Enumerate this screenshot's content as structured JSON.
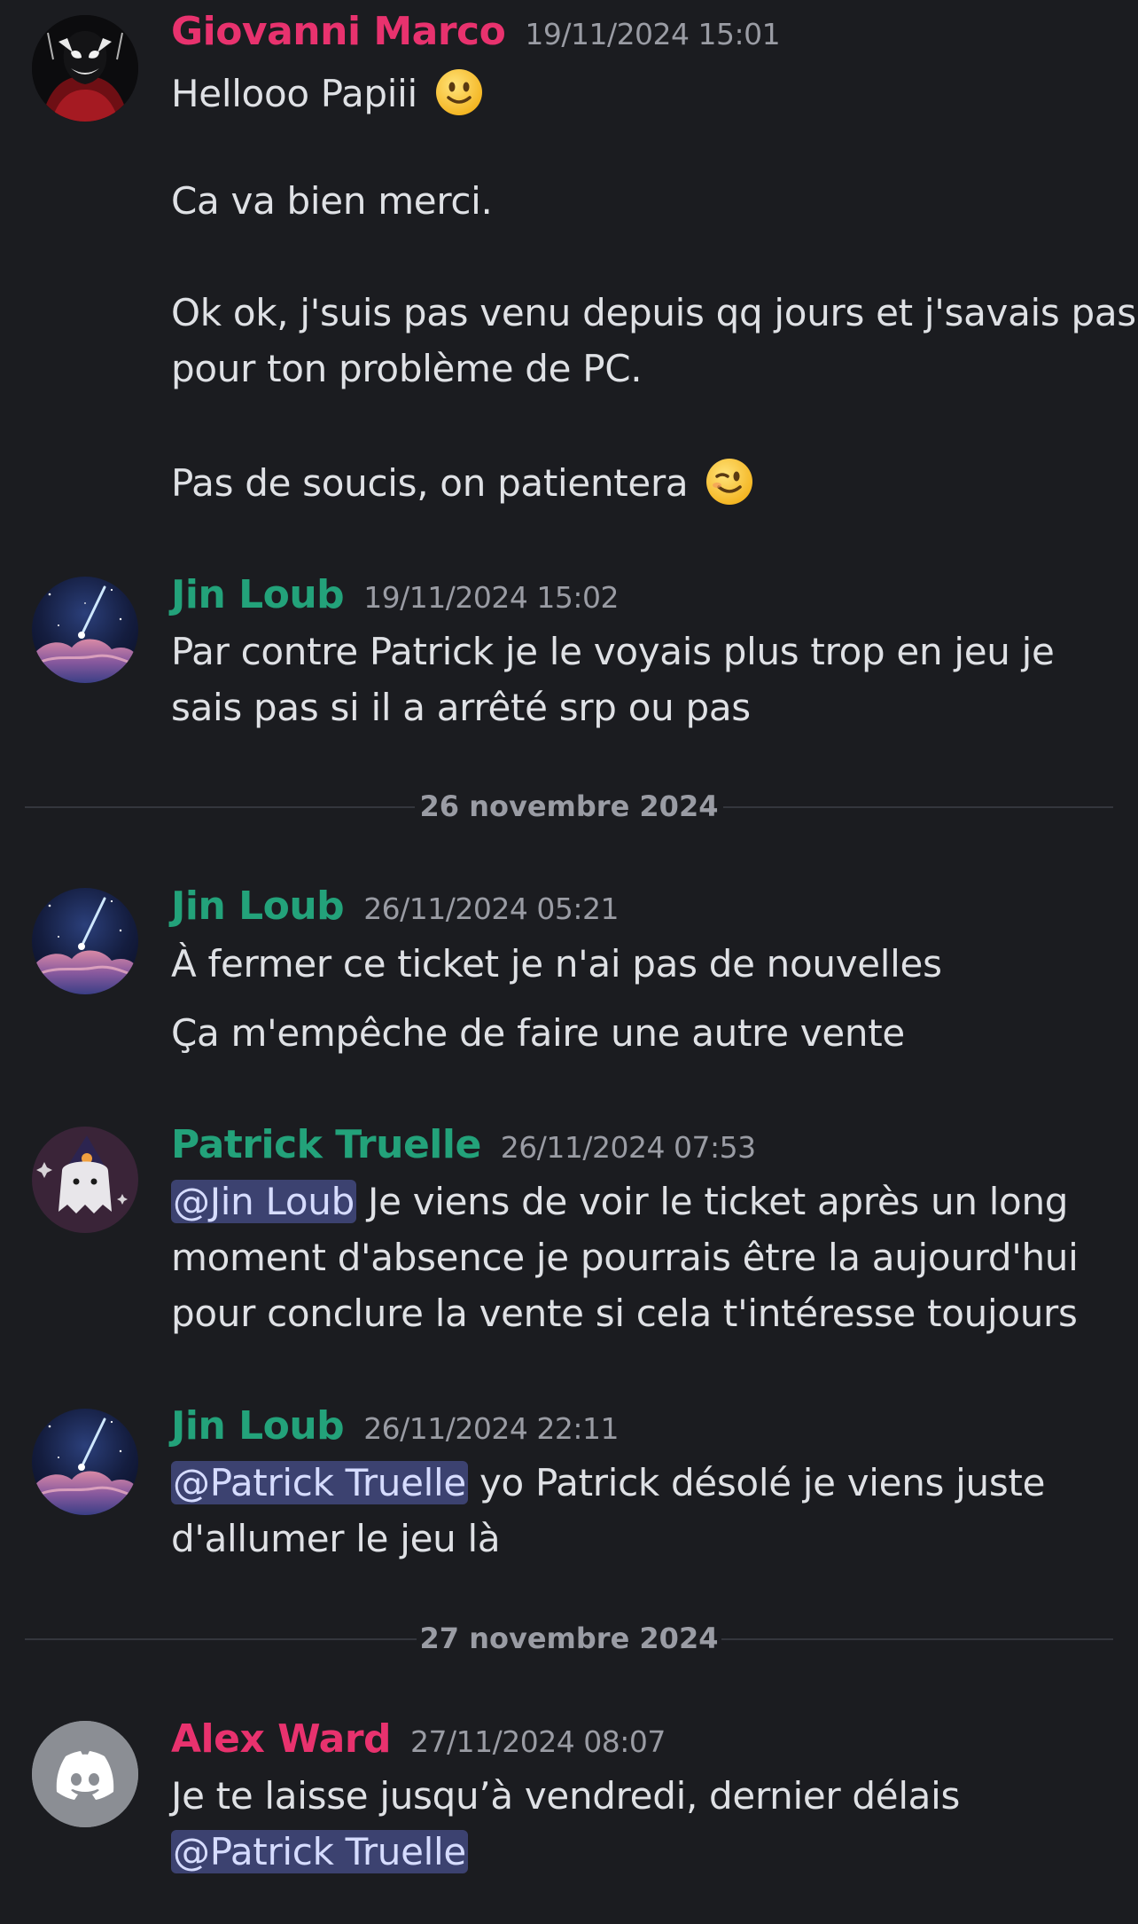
{
  "colors": {
    "background": "#1b1c20",
    "author_pink": "#e8326e",
    "author_green": "#23a27a",
    "mention_bg": "#3c4270",
    "timestamp": "#9a9ca4"
  },
  "messages": [
    {
      "author": "Giovanni Marco",
      "timestamp": "19/11/2024 15:01",
      "lines": [
        "Hellooo Papiii",
        "Ca va bien merci.",
        "Ok ok, j'suis pas venu depuis qq jours et j'savais pas",
        "pour ton problème de PC.",
        "Pas de soucis, on patientera"
      ]
    },
    {
      "author": "Jin Loub",
      "timestamp": "19/11/2024 15:02",
      "lines": [
        "Par contre Patrick je le voyais plus trop en jeu je",
        "sais pas si il a arrêté srp ou pas"
      ]
    },
    {
      "author": "Jin Loub",
      "timestamp": "26/11/2024 05:21",
      "lines": [
        "À fermer ce ticket je n'ai pas de nouvelles",
        "Ça m'empêche de faire une autre vente"
      ]
    },
    {
      "author": "Patrick Truelle",
      "timestamp": "26/11/2024 07:53",
      "mention": "@Jin Loub",
      "lines": [
        "Je viens de voir le ticket après un long",
        "moment d'absence je pourrais être la aujourd'hui",
        "pour conclure la vente si cela t'intéresse toujours"
      ]
    },
    {
      "author": "Jin Loub",
      "timestamp": "26/11/2024 22:11",
      "mention": "@Patrick Truelle",
      "lines": [
        "yo Patrick désolé je viens juste",
        "d'allumer le jeu là"
      ]
    },
    {
      "author": "Alex Ward",
      "timestamp": "27/11/2024 08:07",
      "mention": "@Patrick Truelle",
      "lines": [
        "Je te laisse jusqu’à vendredi, dernier délais"
      ]
    }
  ],
  "dividers": [
    "26 novembre 2024",
    "27 novembre 2024"
  ],
  "icons": {
    "smile": "slightly-smiling-face-emoji",
    "wink": "winking-face-emoji",
    "discord": "discord-logo-icon"
  }
}
